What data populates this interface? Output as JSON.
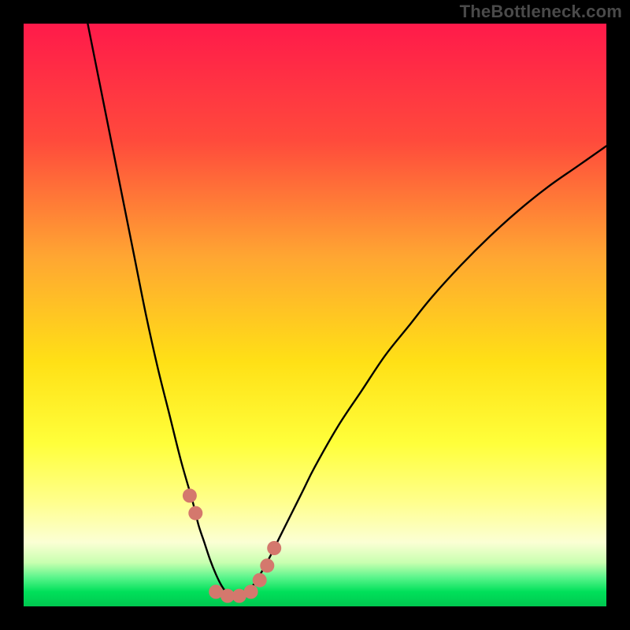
{
  "watermark": "TheBottleneck.com",
  "colors": {
    "frame": "#000000",
    "watermark_text": "#4a4a4a",
    "gradient_top": "#ff1a4a",
    "gradient_mid_upper": "#ff7a2c",
    "gradient_mid": "#ffd400",
    "gradient_lower": "#ffff66",
    "gradient_pale": "#faffcc",
    "gradient_green": "#00e05a",
    "gradient_green2": "#00c850",
    "curve": "#000000",
    "marker_fill": "#d4786d",
    "marker_stroke": "#a85a52"
  },
  "chart_data": {
    "type": "line",
    "title": "",
    "xlabel": "",
    "ylabel": "",
    "xlim": [
      0,
      100
    ],
    "ylim": [
      0,
      100
    ],
    "grid": false,
    "legend": false,
    "notes": "Axes unlabeled in source image. x and y are approximate percentage coordinates read off the plot area (0,0 = bottom-left of colored region, 100,100 = top-right). Curve is a V-shaped function with minimum near x≈36. Point markers highlight samples near the valley.",
    "series": [
      {
        "name": "curve",
        "x": [
          11,
          13,
          15,
          17,
          19,
          21,
          23,
          25,
          27,
          29,
          30,
          31,
          32,
          33,
          34,
          35,
          36,
          37,
          38,
          39,
          40,
          42,
          44,
          46,
          48,
          50,
          54,
          58,
          62,
          66,
          70,
          75,
          80,
          85,
          90,
          95,
          100
        ],
        "y": [
          100,
          90,
          80,
          70,
          60,
          50,
          41,
          33,
          25,
          18,
          14,
          11,
          8,
          5.5,
          3.5,
          2.2,
          1.6,
          1.6,
          2.2,
          3.2,
          4.5,
          8,
          12,
          16,
          20,
          24,
          31,
          37,
          43,
          48,
          53,
          58.5,
          63.5,
          68,
          72,
          75.5,
          79
        ],
        "style": "line"
      },
      {
        "name": "markers",
        "x": [
          28.5,
          29.5,
          33,
          35,
          37,
          39,
          40.5,
          41.8,
          43
        ],
        "y": [
          19,
          16,
          2.5,
          1.8,
          1.8,
          2.5,
          4.5,
          7,
          10
        ],
        "style": "points"
      }
    ]
  }
}
